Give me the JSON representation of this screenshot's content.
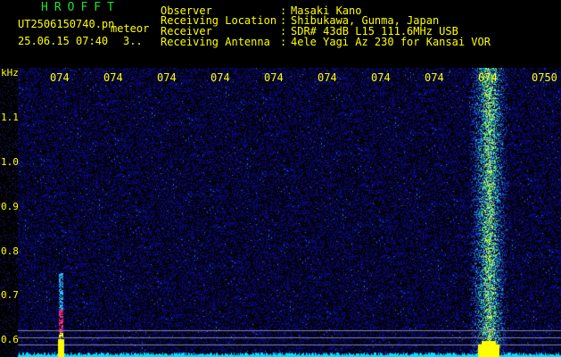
{
  "header": {
    "app_name": "HROFFT",
    "file_name": "UT2506150740.pn",
    "mode_label": "meteor",
    "date_time": "25.06.15 07:40",
    "count": "3..",
    "info_labels": [
      "Observer",
      "Receiving Location",
      "Receiver",
      "Receiving Antenna"
    ],
    "info_colons": [
      ":",
      ":",
      ":",
      ":"
    ],
    "info_values": [
      "Masaki Kano",
      "Shibukawa, Gunma, Japan",
      "SDR# 43dB L15 111.6MHz USB",
      "4ele Yagi Az 230 for Kansai VOR"
    ]
  },
  "axis": {
    "unit": "kHz",
    "y_ticks": [
      "1.1",
      "1.0",
      "0.9",
      "0.8",
      "0.7",
      "0.6"
    ],
    "x_ticks": [
      "074",
      "074",
      "074",
      "074",
      "074",
      "074",
      "074",
      "074",
      "074",
      "0750"
    ]
  },
  "colors": {
    "background": "#000000",
    "noise": "#1a1a8c",
    "label": "#ffff00",
    "title": "#22e02a",
    "baseline": "#00ffff"
  }
}
